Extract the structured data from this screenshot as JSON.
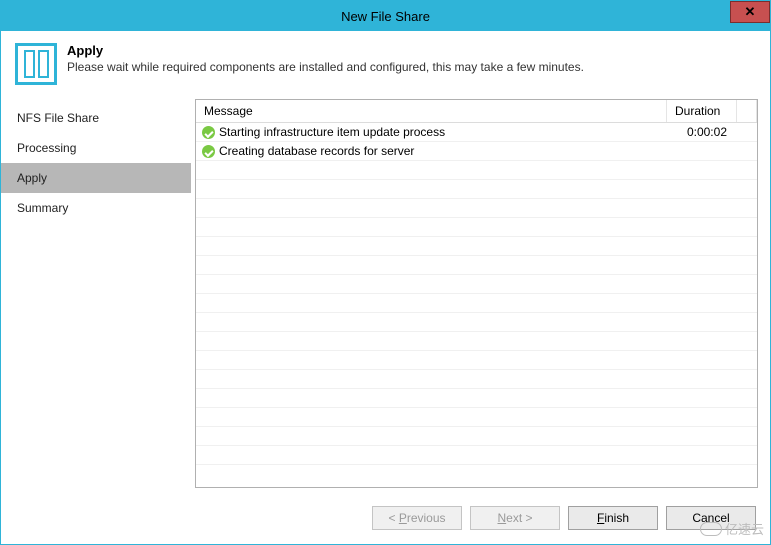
{
  "window": {
    "title": "New File Share"
  },
  "header": {
    "title": "Apply",
    "subtitle": "Please wait while required components are installed and configured, this may take a few minutes."
  },
  "sidebar": {
    "items": [
      {
        "label": "NFS File Share",
        "active": false
      },
      {
        "label": "Processing",
        "active": false
      },
      {
        "label": "Apply",
        "active": true
      },
      {
        "label": "Summary",
        "active": false
      }
    ]
  },
  "grid": {
    "columns": {
      "message": "Message",
      "duration": "Duration"
    },
    "rows": [
      {
        "status": "ok",
        "message": "Starting infrastructure item update process",
        "duration": "0:00:02"
      },
      {
        "status": "ok",
        "message": "Creating database records for server",
        "duration": ""
      }
    ],
    "blankRows": 16
  },
  "footer": {
    "previous": {
      "prefix": "< ",
      "u": "P",
      "rest": "revious",
      "enabled": false
    },
    "next": {
      "u": "N",
      "rest": "ext >",
      "enabled": false
    },
    "finish": {
      "u": "F",
      "rest": "inish",
      "enabled": true
    },
    "cancel": {
      "label": "Cancel",
      "enabled": true
    }
  },
  "watermark": "亿速云"
}
